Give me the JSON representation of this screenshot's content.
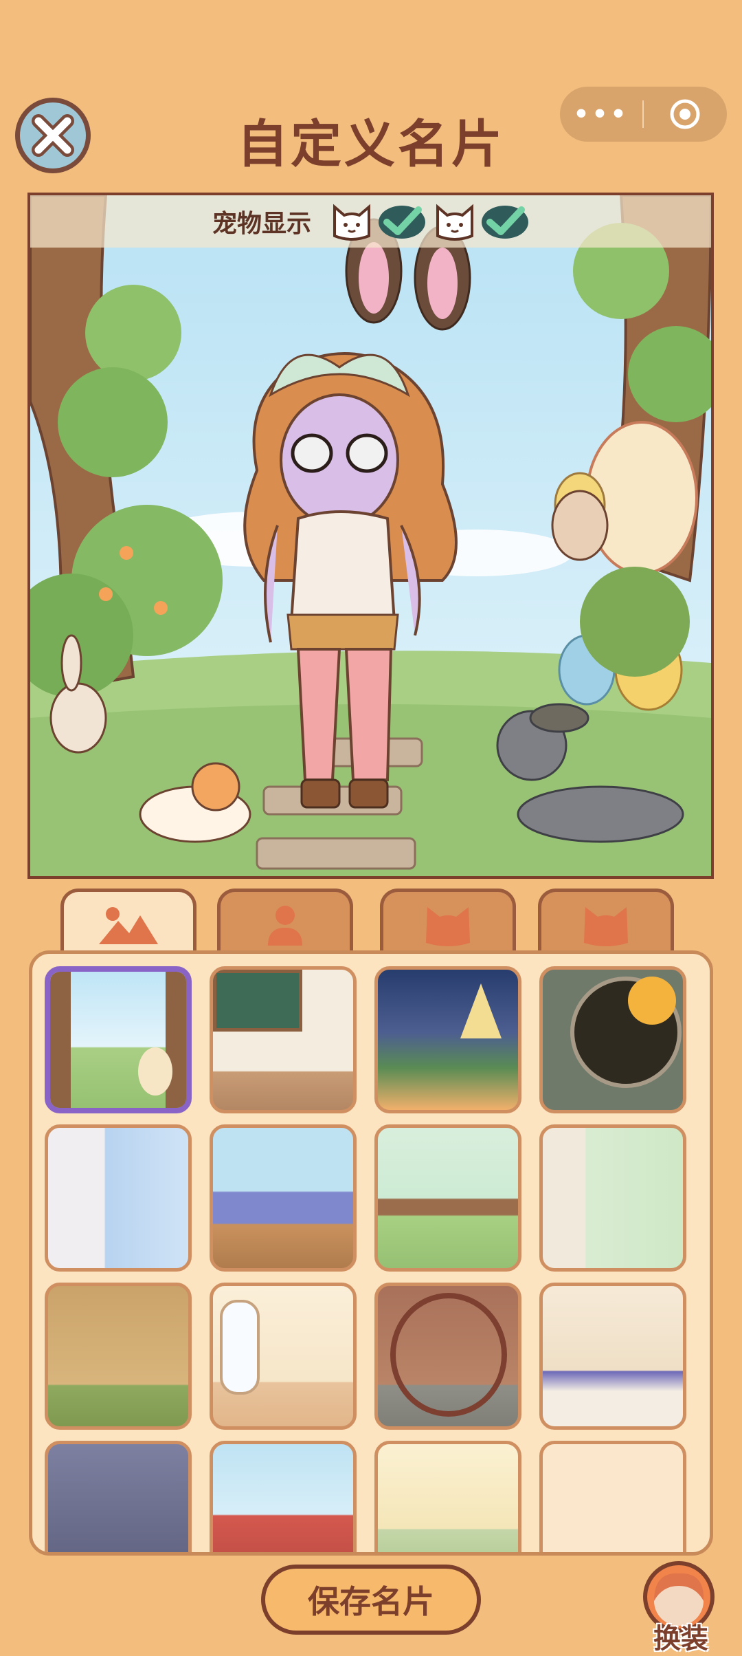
{
  "header": {
    "title": "自定义名片",
    "close_icon": "close-icon",
    "more_icon": "more-dots-icon",
    "exit_icon": "target-icon"
  },
  "scene": {
    "pet_display_label": "宠物显示",
    "pet_toggles": [
      {
        "icon": "cat-face-icon",
        "checked": true
      },
      {
        "icon": "cat-face-icon",
        "checked": true
      }
    ]
  },
  "tabs": [
    {
      "icon": "landscape-icon",
      "active": true
    },
    {
      "icon": "person-icon",
      "active": false
    },
    {
      "icon": "cat-head-icon",
      "active": false
    },
    {
      "icon": "cat-head-icon",
      "active": false
    }
  ],
  "backgrounds": [
    {
      "theme": "forest-easter",
      "selected": true
    },
    {
      "theme": "classroom",
      "selected": false
    },
    {
      "theme": "crystal-night",
      "selected": false
    },
    {
      "theme": "round-window-autumn",
      "selected": false
    },
    {
      "theme": "white-curtain-room",
      "selected": false
    },
    {
      "theme": "flower-balcony",
      "selected": false
    },
    {
      "theme": "spring-fence",
      "selected": false
    },
    {
      "theme": "greenhouse-studio",
      "selected": false
    },
    {
      "theme": "bamboo-garden",
      "selected": false
    },
    {
      "theme": "cozy-fox-room",
      "selected": false
    },
    {
      "theme": "chinese-moon-gate",
      "selected": false
    },
    {
      "theme": "royal-garden",
      "selected": false
    },
    {
      "theme": "gothic-hall",
      "selected": false
    },
    {
      "theme": "festival-flowers",
      "selected": false
    },
    {
      "theme": "sunny-window",
      "selected": false
    },
    {
      "theme": "cream-wallpaper",
      "selected": false
    }
  ],
  "footer": {
    "save_label": "保存名片",
    "dress_label": "换装"
  },
  "colors": {
    "page_bg": "#f2bd7d",
    "accent_brown": "#7b3f2c",
    "selected_border": "#8a63c7",
    "check_green": "#3f9e74"
  }
}
